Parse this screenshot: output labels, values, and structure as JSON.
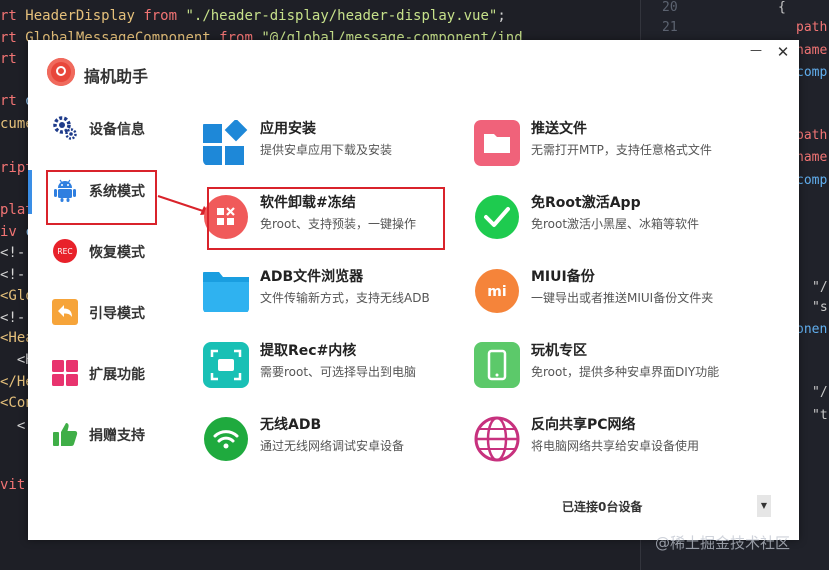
{
  "editor": {
    "left_lines": [
      {
        "parts": [
          [
            "kw",
            "rt "
          ],
          [
            "id",
            "HeaderDisplay "
          ],
          [
            "kw",
            "from "
          ],
          [
            "str",
            "\"./header-display/header-display.vue\""
          ],
          [
            "",
            "; "
          ]
        ]
      },
      {
        "parts": [
          [
            "kw",
            "rt "
          ],
          [
            "id",
            "GlobalMessageComponent "
          ],
          [
            "kw",
            "from "
          ],
          [
            "str",
            "\"@/global/message-component/ind"
          ]
        ]
      },
      {
        "parts": [
          [
            "kw",
            "rt "
          ]
        ]
      },
      {
        "parts": [
          [
            "",
            ""
          ]
        ]
      },
      {
        "parts": [
          [
            "kw",
            "rt "
          ],
          [
            "tag",
            "o"
          ]
        ]
      },
      {
        "parts": [
          [
            "id",
            "cume"
          ]
        ]
      },
      {
        "parts": [
          [
            "",
            ""
          ]
        ]
      },
      {
        "parts": [
          [
            "kw",
            "ript"
          ]
        ]
      },
      {
        "parts": [
          [
            "",
            ""
          ]
        ]
      },
      {
        "parts": [
          [
            "kw",
            "plat"
          ]
        ]
      },
      {
        "parts": [
          [
            "kw",
            "iv "
          ],
          [
            "tag",
            "c"
          ]
        ]
      },
      {
        "parts": [
          [
            "",
            "<!-"
          ]
        ]
      },
      {
        "parts": [
          [
            "",
            "<!-"
          ]
        ]
      },
      {
        "parts": [
          [
            "id",
            "<Glo"
          ]
        ]
      },
      {
        "parts": [
          [
            "",
            "<!-"
          ]
        ]
      },
      {
        "parts": [
          [
            "id",
            "<Hea"
          ]
        ]
      },
      {
        "parts": [
          [
            "",
            "  <H"
          ]
        ]
      },
      {
        "parts": [
          [
            "id",
            "</He"
          ]
        ]
      },
      {
        "parts": [
          [
            "id",
            "<Con"
          ]
        ]
      },
      {
        "parts": [
          [
            "",
            "  <"
          ]
        ]
      },
      {
        "parts": [
          [
            "",
            ""
          ]
        ]
      },
      {
        "parts": [
          [
            "kw",
            "vit"
          ]
        ]
      }
    ],
    "gutter": [
      "20",
      "21"
    ],
    "right_lines": [
      {
        "cls": "white",
        "text": "{"
      },
      {
        "cls": "",
        "text": "path"
      },
      {
        "cls": "",
        "text": "name"
      },
      {
        "cls": "blue",
        "text": "comp"
      },
      {
        "cls": "",
        "text": ""
      },
      {
        "cls": "",
        "text": "path"
      },
      {
        "cls": "",
        "text": "name"
      },
      {
        "cls": "blue",
        "text": "comp"
      },
      {
        "cls": "white",
        "text": "\"/"
      },
      {
        "cls": "white",
        "text": "\"s"
      },
      {
        "cls": "blue",
        "text": "onen"
      },
      {
        "cls": "white",
        "text": "\"/"
      },
      {
        "cls": "white",
        "text": "\"t"
      }
    ]
  },
  "window": {
    "title": "搞机助手",
    "minimize_label": "—",
    "close_label": "✕"
  },
  "sidebar": {
    "items": [
      {
        "label": "设备信息",
        "icon": "gear-icon"
      },
      {
        "label": "系统模式",
        "icon": "android-icon"
      },
      {
        "label": "恢复模式",
        "icon": "rec-icon",
        "icon_text": "REC"
      },
      {
        "label": "引导模式",
        "icon": "back-arrow-icon"
      },
      {
        "label": "扩展功能",
        "icon": "grid-icon"
      },
      {
        "label": "捐赠支持",
        "icon": "thumbs-up-icon"
      }
    ],
    "active_index": 1
  },
  "tiles": [
    {
      "title": "应用安装",
      "desc": "提供安卓应用下载及安装",
      "icon": "app-install-icon",
      "color": "#1e88d8"
    },
    {
      "title": "推送文件",
      "desc": "无需打开MTP，支持任意格式文件",
      "icon": "folder-push-icon",
      "color": "#f0627a"
    },
    {
      "title": "软件卸载#冻结",
      "desc": "免root、支持预装，一键操作",
      "icon": "uninstall-icon",
      "color": "#f05a5a"
    },
    {
      "title": "免Root激活App",
      "desc": "免root激活小黑屋、冰箱等软件",
      "icon": "check-icon",
      "color": "#1ecb4f"
    },
    {
      "title": "ADB文件浏览器",
      "desc": "文件传输新方式，支持无线ADB",
      "icon": "file-browser-icon",
      "color": "#1a9ee0"
    },
    {
      "title": "MIUI备份",
      "desc": "一键导出或者推送MIUI备份文件夹",
      "icon": "mi-icon",
      "color": "#f5843a",
      "icon_text": "mi"
    },
    {
      "title": "提取Rec#内核",
      "desc": "需要root、可选择导出到电脑",
      "icon": "extract-icon",
      "color": "#19c0b5"
    },
    {
      "title": "玩机专区",
      "desc": "免root，提供多种安卓界面DIY功能",
      "icon": "phone-icon",
      "color": "#5cc96a"
    },
    {
      "title": "无线ADB",
      "desc": "通过无线网络调试安卓设备",
      "icon": "wifi-icon",
      "color": "#1faa3e"
    },
    {
      "title": "反向共享PC网络",
      "desc": "将电脑网络共享给安卓设备使用",
      "icon": "globe-icon",
      "color": "#c7317e"
    }
  ],
  "status": {
    "text": "已连接0台设备",
    "dropdown_glyph": "▼"
  },
  "annotation": {
    "color": "#d9232b"
  },
  "watermark": "@稀土掘金技术社区"
}
